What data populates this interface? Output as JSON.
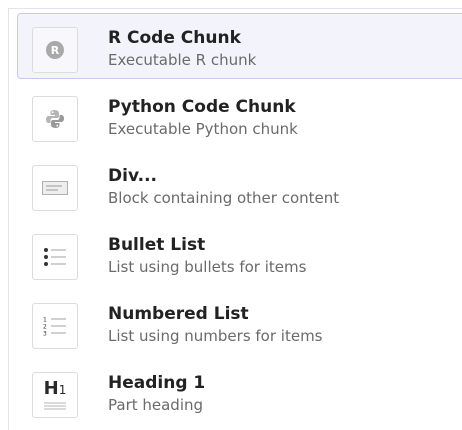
{
  "menu": {
    "items": [
      {
        "icon": "r-logo-icon",
        "title": "R Code Chunk",
        "subtitle": "Executable R chunk",
        "selected": true
      },
      {
        "icon": "python-logo-icon",
        "title": "Python Code Chunk",
        "subtitle": "Executable Python chunk",
        "selected": false
      },
      {
        "icon": "div-block-icon",
        "title": "Div...",
        "subtitle": "Block containing other content",
        "selected": false
      },
      {
        "icon": "bullet-list-icon",
        "title": "Bullet List",
        "subtitle": "List using bullets for items",
        "selected": false
      },
      {
        "icon": "numbered-list-icon",
        "title": "Numbered List",
        "subtitle": "List using numbers for items",
        "selected": false
      },
      {
        "icon": "heading-1-icon",
        "title": "Heading 1",
        "subtitle": "Part heading",
        "selected": false,
        "glyph": "H1"
      }
    ]
  },
  "colors": {
    "selected_bg": "#f3f3fb",
    "selected_border": "#c9c8ec",
    "title": "#222222",
    "subtitle": "#6a6a6a",
    "icon_gray": "#a9a9a9"
  }
}
